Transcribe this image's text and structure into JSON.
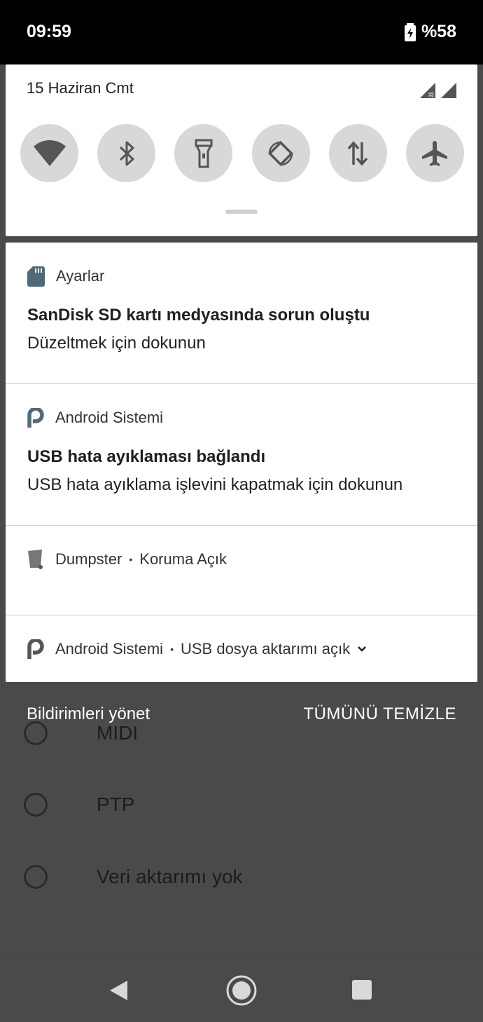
{
  "status_bar": {
    "time": "09:59",
    "battery": "%58"
  },
  "quick_settings": {
    "date": "15 Haziran Cmt",
    "tiles": [
      {
        "icon": "wifi-icon"
      },
      {
        "icon": "bluetooth-icon"
      },
      {
        "icon": "flashlight-icon"
      },
      {
        "icon": "auto-rotate-icon"
      },
      {
        "icon": "mobile-data-icon"
      },
      {
        "icon": "airplane-icon"
      }
    ]
  },
  "notifications": [
    {
      "app": "Ayarlar",
      "title": "SanDisk SD kartı medyasında sorun oluştu",
      "text": "Düzeltmek için dokunun",
      "icon": "sd-card-icon"
    },
    {
      "app": "Android Sistemi",
      "title": "USB hata ayıklaması bağlandı",
      "text": "USB hata ayıklama işlevini kapatmak için dokunun",
      "icon": "android-p-icon"
    },
    {
      "app": "Dumpster",
      "sub": "Koruma Açık",
      "icon": "trash-icon"
    },
    {
      "app": "Android Sistemi",
      "sub": "USB dosya aktarımı açık",
      "icon": "android-p-icon"
    }
  ],
  "actions": {
    "manage": "Bildirimleri yönet",
    "clear_all": "TÜMÜNÜ TEMİZLE"
  },
  "background_options": [
    "MIDI",
    "PTP",
    "Veri aktarımı yok"
  ],
  "colors": {
    "scrim": "#4a4a4a",
    "tile_bg": "#d8d8d8",
    "icon_tint": "#555555",
    "app_icon": "#4f6b7a"
  }
}
